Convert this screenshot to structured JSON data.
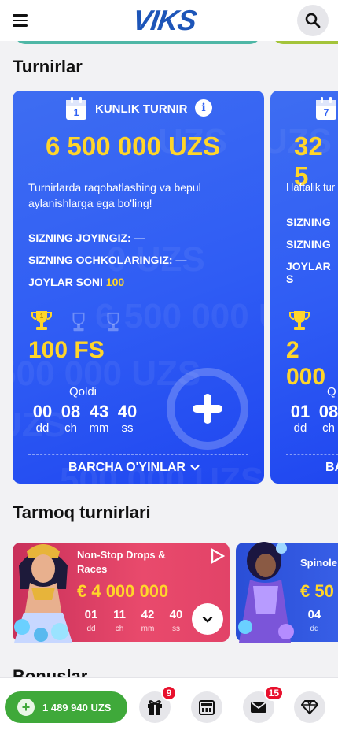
{
  "header": {
    "logo_text": "VIKS",
    "menu_icon": "hamburger-menu-icon",
    "search_icon": "search-icon"
  },
  "sections": {
    "tournaments_title": "Turnirlar",
    "network_title": "Tarmoq turnirlari",
    "bonuses_title": "Bonuslar"
  },
  "tournaments": [
    {
      "calendar_day": "1",
      "type_label": "KUNLIK TURNIR",
      "prize": "6 500 000 UZS",
      "description": "Turnirlarda raqobatlashing va bepul aylanishlarga ega bo'ling!",
      "place_label": "SIZNING JOYINGIZ: —",
      "points_label": "SIZNING OCHKOLARINGIZ: —",
      "places_label": "JOYLAR SONI",
      "places_value": "100",
      "reward": "100 FS",
      "remaining_label": "Qoldi",
      "countdown": [
        {
          "value": "00",
          "unit": "dd"
        },
        {
          "value": "08",
          "unit": "ch"
        },
        {
          "value": "43",
          "unit": "mm"
        },
        {
          "value": "40",
          "unit": "ss"
        }
      ],
      "all_games_label": "BARCHA O'YINLAR",
      "watermark": "6 500 000 UZS"
    },
    {
      "calendar_day": "7",
      "prize": "32 5",
      "description": "Haftalik tur",
      "place_label": "SIZNING",
      "points_label": "SIZNING",
      "places_label": "JOYLAR S",
      "reward": "2 000",
      "remaining_label": "Q",
      "countdown": [
        {
          "value": "01",
          "unit": "dd"
        },
        {
          "value": "08",
          "unit": "ch"
        }
      ],
      "all_games_label": "BA"
    }
  ],
  "network_tournaments": [
    {
      "title_line1": "Non-Stop Drops &",
      "title_line2": "Races",
      "prize": "€ 4 000 000",
      "countdown": [
        {
          "value": "01",
          "unit": "dd"
        },
        {
          "value": "11",
          "unit": "ch"
        },
        {
          "value": "42",
          "unit": "mm"
        },
        {
          "value": "40",
          "unit": "ss"
        }
      ]
    },
    {
      "title_line1": "Spinole",
      "prize": "€ 50",
      "countdown": [
        {
          "value": "04",
          "unit": "dd"
        }
      ]
    }
  ],
  "bottom_bar": {
    "balance": "1 489 940 UZS",
    "gift_badge": "9",
    "mail_badge": "15"
  },
  "colors": {
    "card_blue": "#2f5cf4",
    "prize_yellow": "#ffd52a",
    "balance_green": "#3fa93a",
    "badge_red": "#e8102c",
    "logo_blue": "#1d55b8"
  }
}
